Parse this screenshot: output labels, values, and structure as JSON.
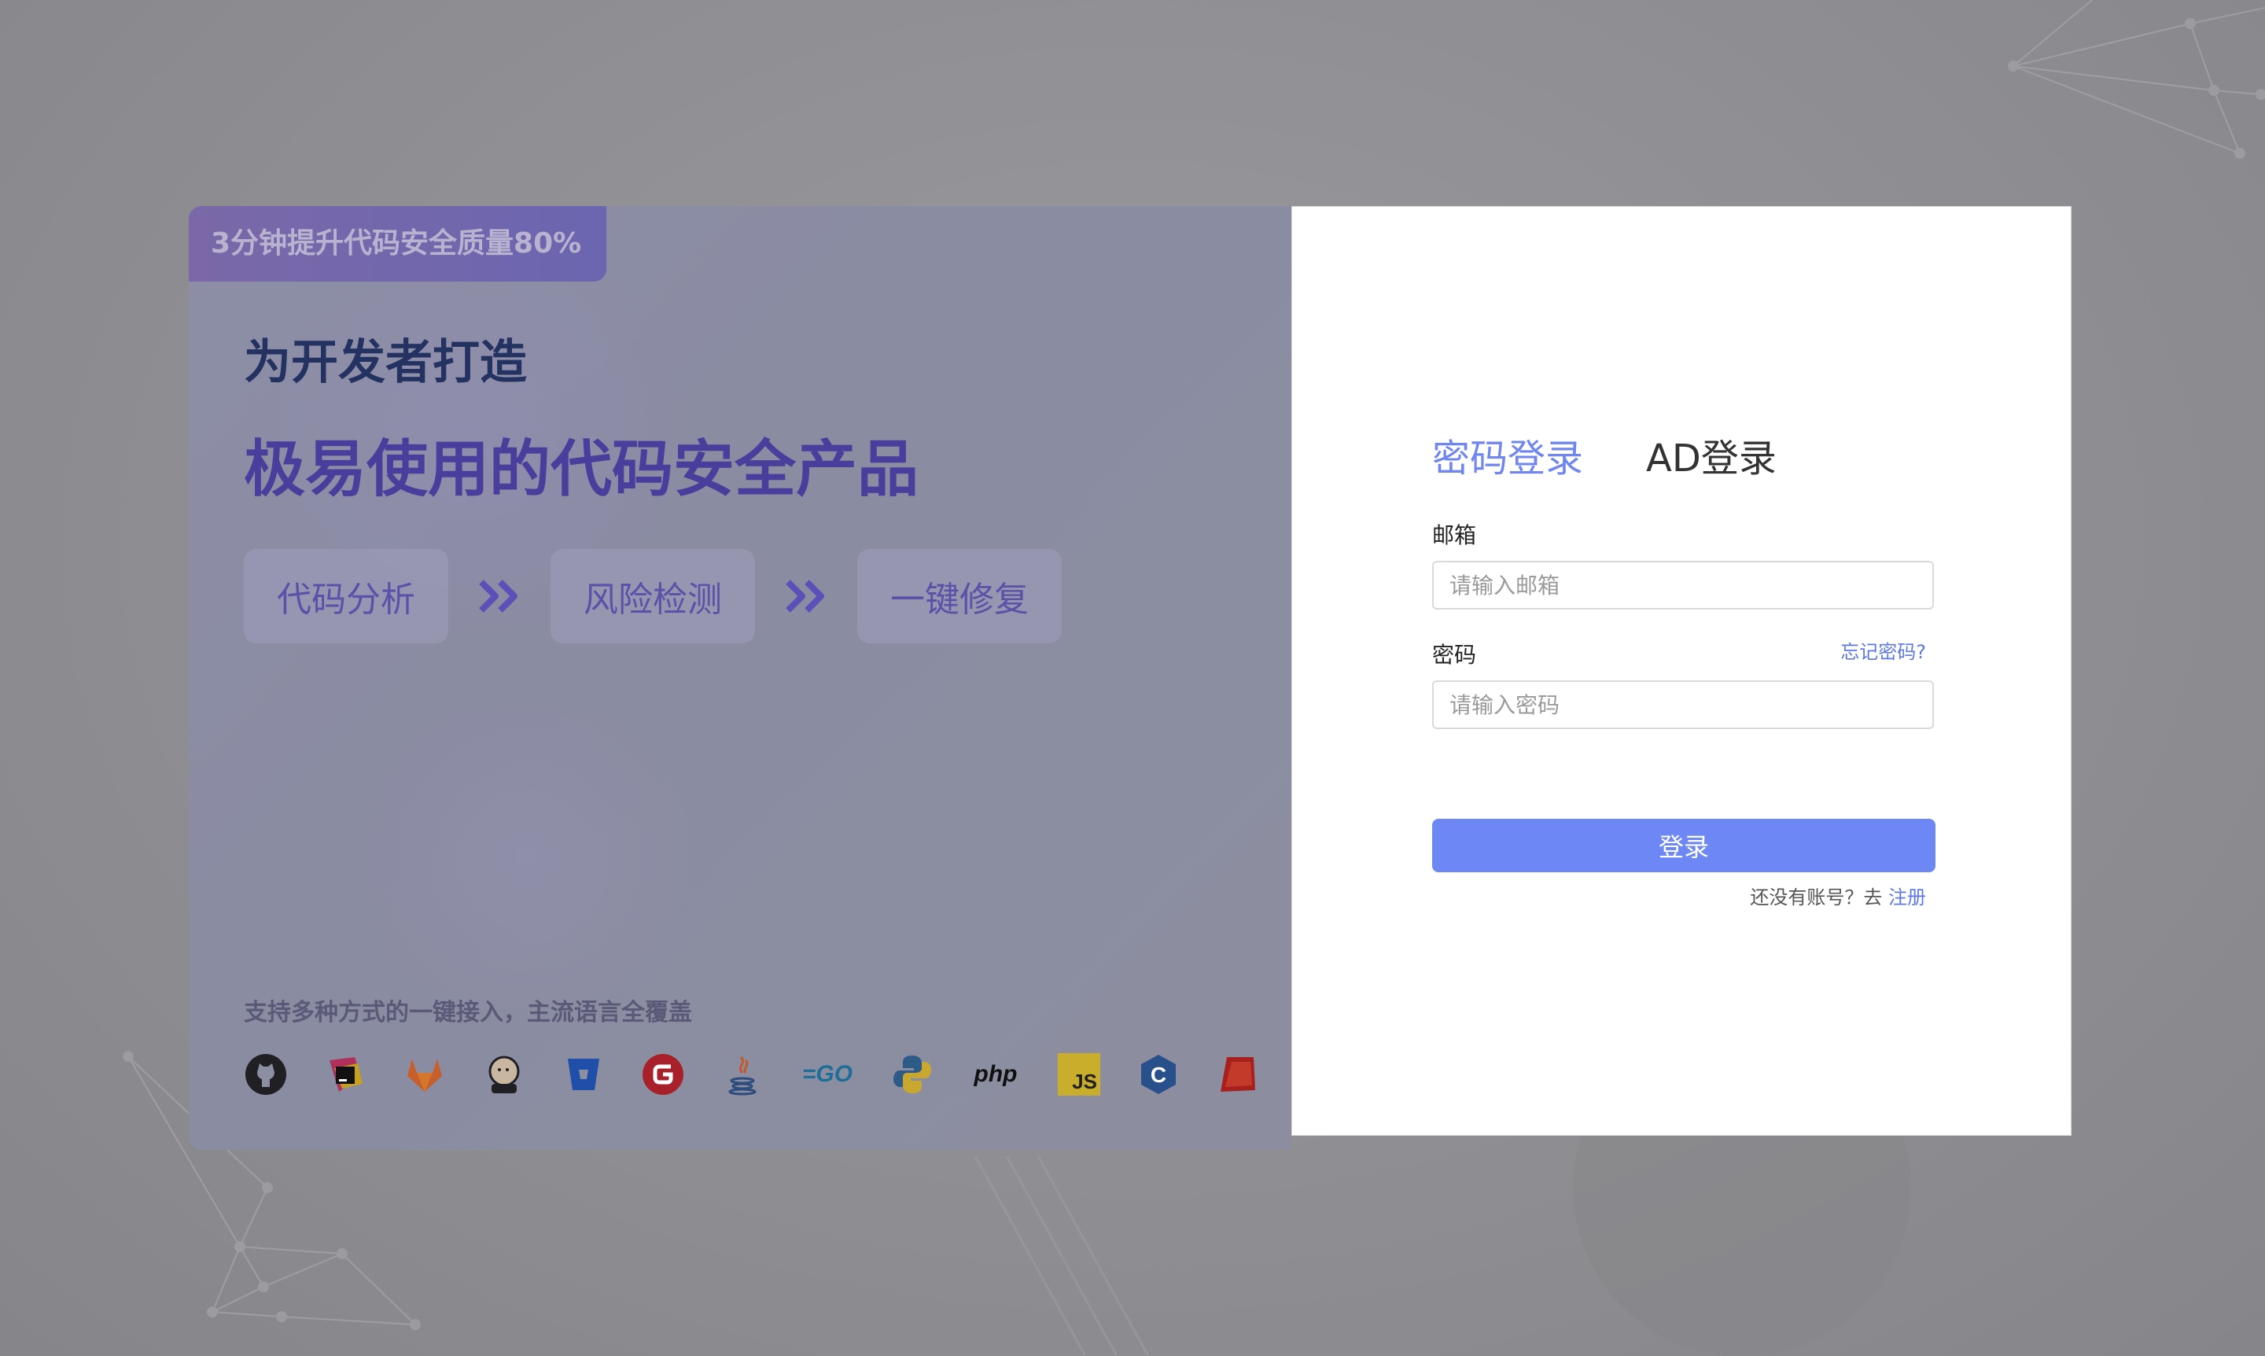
{
  "promo": {
    "badge": "3分钟提升代码安全质量80%",
    "title_line1": "为开发者打造",
    "title_line2": "极易使用的代码安全产品",
    "steps": [
      "代码分析",
      "风险检测",
      "一键修复"
    ],
    "support_text": "支持多种方式的一键接入，主流语言全覆盖",
    "integrations": [
      {
        "icon": "github-icon"
      },
      {
        "icon": "jetbrains-icon"
      },
      {
        "icon": "gitlab-icon"
      },
      {
        "icon": "jenkins-icon"
      },
      {
        "icon": "bitbucket-icon"
      },
      {
        "icon": "gitee-icon"
      },
      {
        "icon": "java-icon"
      },
      {
        "icon": "go-icon",
        "label": "=GO"
      },
      {
        "icon": "python-icon"
      },
      {
        "icon": "php-icon",
        "label": "php"
      },
      {
        "icon": "javascript-icon",
        "label": "JS"
      },
      {
        "icon": "c-language-icon",
        "label": "C"
      },
      {
        "icon": "ruby-icon"
      }
    ]
  },
  "login": {
    "tab_password": "密码登录",
    "tab_ad": "AD登录",
    "email_label": "邮箱",
    "email_placeholder": "请输入邮箱",
    "password_label": "密码",
    "password_placeholder": "请输入密码",
    "forgot_password": "忘记密码?",
    "submit_label": "登录",
    "no_account_text": "还没有账号？去",
    "register_link": "注册"
  },
  "colors": {
    "accent": "#6d88f5",
    "link": "#5c78e8",
    "promo_title": "#243261",
    "promo_headline": "#4a3e9c"
  }
}
